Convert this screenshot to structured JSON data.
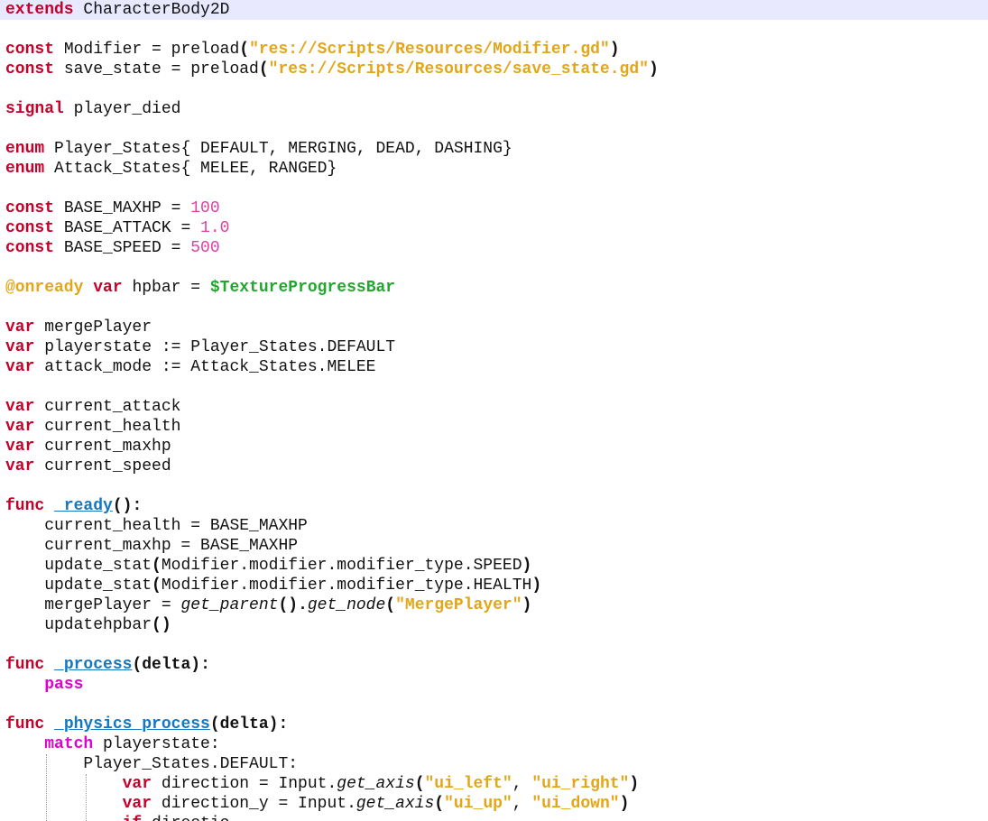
{
  "editor": {
    "lines": [
      [
        {
          "t": "extends",
          "c": "kw"
        },
        {
          "t": " CharacterBody2D",
          "c": "plain"
        }
      ],
      [],
      [
        {
          "t": "const",
          "c": "kw"
        },
        {
          "t": " Modifier = preload",
          "c": "plain"
        },
        {
          "t": "(",
          "c": "punct"
        },
        {
          "t": "\"res://Scripts/Resources/Modifier.gd\"",
          "c": "str"
        },
        {
          "t": ")",
          "c": "punct"
        }
      ],
      [
        {
          "t": "const",
          "c": "kw"
        },
        {
          "t": " save_state = preload",
          "c": "plain"
        },
        {
          "t": "(",
          "c": "punct"
        },
        {
          "t": "\"res://Scripts/Resources/save_state.gd\"",
          "c": "str"
        },
        {
          "t": ")",
          "c": "punct"
        }
      ],
      [],
      [
        {
          "t": "signal",
          "c": "kw"
        },
        {
          "t": " player_died",
          "c": "plain"
        }
      ],
      [],
      [
        {
          "t": "enum",
          "c": "kw"
        },
        {
          "t": " Player_States{ DEFAULT, MERGING, DEAD, DASHING}",
          "c": "plain"
        }
      ],
      [
        {
          "t": "enum",
          "c": "kw"
        },
        {
          "t": " Attack_States{ MELEE, RANGED}",
          "c": "plain"
        }
      ],
      [],
      [
        {
          "t": "const",
          "c": "kw"
        },
        {
          "t": " BASE_MAXHP = ",
          "c": "plain"
        },
        {
          "t": "100",
          "c": "num"
        }
      ],
      [
        {
          "t": "const",
          "c": "kw"
        },
        {
          "t": " BASE_ATTACK = ",
          "c": "plain"
        },
        {
          "t": "1.0",
          "c": "num"
        }
      ],
      [
        {
          "t": "const",
          "c": "kw"
        },
        {
          "t": " BASE_SPEED = ",
          "c": "plain"
        },
        {
          "t": "500",
          "c": "num"
        }
      ],
      [],
      [
        {
          "t": "@onready",
          "c": "anno"
        },
        {
          "t": " ",
          "c": "plain"
        },
        {
          "t": "var",
          "c": "kw"
        },
        {
          "t": " hpbar = ",
          "c": "plain"
        },
        {
          "t": "$TextureProgressBar",
          "c": "nodepath"
        }
      ],
      [],
      [
        {
          "t": "var",
          "c": "kw"
        },
        {
          "t": " mergePlayer",
          "c": "plain"
        }
      ],
      [
        {
          "t": "var",
          "c": "kw"
        },
        {
          "t": " playerstate := Player_States.DEFAULT",
          "c": "plain"
        }
      ],
      [
        {
          "t": "var",
          "c": "kw"
        },
        {
          "t": " attack_mode := Attack_States.MELEE",
          "c": "plain"
        }
      ],
      [],
      [
        {
          "t": "var",
          "c": "kw"
        },
        {
          "t": " current_attack",
          "c": "plain"
        }
      ],
      [
        {
          "t": "var",
          "c": "kw"
        },
        {
          "t": " current_health",
          "c": "plain"
        }
      ],
      [
        {
          "t": "var",
          "c": "kw"
        },
        {
          "t": " current_maxhp",
          "c": "plain"
        }
      ],
      [
        {
          "t": "var",
          "c": "kw"
        },
        {
          "t": " current_speed",
          "c": "plain"
        }
      ],
      [],
      [
        {
          "t": "func",
          "c": "kw"
        },
        {
          "t": " ",
          "c": "plain"
        },
        {
          "t": "_ready",
          "c": "func"
        },
        {
          "t": "():",
          "c": "punct"
        }
      ],
      [
        {
          "t": "    current_health = BASE_MAXHP",
          "c": "plain"
        }
      ],
      [
        {
          "t": "    current_maxhp = BASE_MAXHP",
          "c": "plain"
        }
      ],
      [
        {
          "t": "    update_stat",
          "c": "plain"
        },
        {
          "t": "(",
          "c": "punct"
        },
        {
          "t": "Modifier.modifier.modifier_type.SPEED",
          "c": "plain"
        },
        {
          "t": ")",
          "c": "punct"
        }
      ],
      [
        {
          "t": "    update_stat",
          "c": "plain"
        },
        {
          "t": "(",
          "c": "punct"
        },
        {
          "t": "Modifier.modifier.modifier_type.HEALTH",
          "c": "plain"
        },
        {
          "t": ")",
          "c": "punct"
        }
      ],
      [
        {
          "t": "    mergePlayer = ",
          "c": "plain"
        },
        {
          "t": "get_parent",
          "c": "call"
        },
        {
          "t": "().",
          "c": "punct"
        },
        {
          "t": "get_node",
          "c": "call"
        },
        {
          "t": "(",
          "c": "punct"
        },
        {
          "t": "\"MergePlayer\"",
          "c": "str"
        },
        {
          "t": ")",
          "c": "punct"
        }
      ],
      [
        {
          "t": "    updatehpbar",
          "c": "plain"
        },
        {
          "t": "()",
          "c": "punct"
        }
      ],
      [],
      [
        {
          "t": "func",
          "c": "kw"
        },
        {
          "t": " ",
          "c": "plain"
        },
        {
          "t": "_process",
          "c": "func"
        },
        {
          "t": "(delta):",
          "c": "punct"
        }
      ],
      [
        {
          "t": "    ",
          "c": "plain"
        },
        {
          "t": "pass",
          "c": "kw2"
        }
      ],
      [],
      [
        {
          "t": "func",
          "c": "kw"
        },
        {
          "t": " ",
          "c": "plain"
        },
        {
          "t": "_physics_process",
          "c": "func"
        },
        {
          "t": "(delta):",
          "c": "punct"
        }
      ],
      [
        {
          "t": "    ",
          "c": "plain"
        },
        {
          "t": "match",
          "c": "kw2"
        },
        {
          "t": " playerstate:",
          "c": "plain"
        }
      ],
      [
        {
          "t": "        Player_States.DEFAULT:",
          "c": "plain"
        }
      ],
      [
        {
          "t": "            ",
          "c": "plain"
        },
        {
          "t": "var",
          "c": "kw"
        },
        {
          "t": " direction = Input.",
          "c": "plain"
        },
        {
          "t": "get_axis",
          "c": "call"
        },
        {
          "t": "(",
          "c": "punct"
        },
        {
          "t": "\"ui_left\"",
          "c": "str"
        },
        {
          "t": ", ",
          "c": "plain"
        },
        {
          "t": "\"ui_right\"",
          "c": "str"
        },
        {
          "t": ")",
          "c": "punct"
        }
      ],
      [
        {
          "t": "            ",
          "c": "plain"
        },
        {
          "t": "var",
          "c": "kw"
        },
        {
          "t": " direction_y = Input.",
          "c": "plain"
        },
        {
          "t": "get_axis",
          "c": "call"
        },
        {
          "t": "(",
          "c": "punct"
        },
        {
          "t": "\"ui_up\"",
          "c": "str"
        },
        {
          "t": ", ",
          "c": "plain"
        },
        {
          "t": "\"ui_down\"",
          "c": "str"
        },
        {
          "t": ")",
          "c": "punct"
        }
      ],
      [
        {
          "t": "            ",
          "c": "plain"
        },
        {
          "t": "if",
          "c": "kw"
        },
        {
          "t": " directio",
          "c": "plain"
        }
      ]
    ]
  }
}
